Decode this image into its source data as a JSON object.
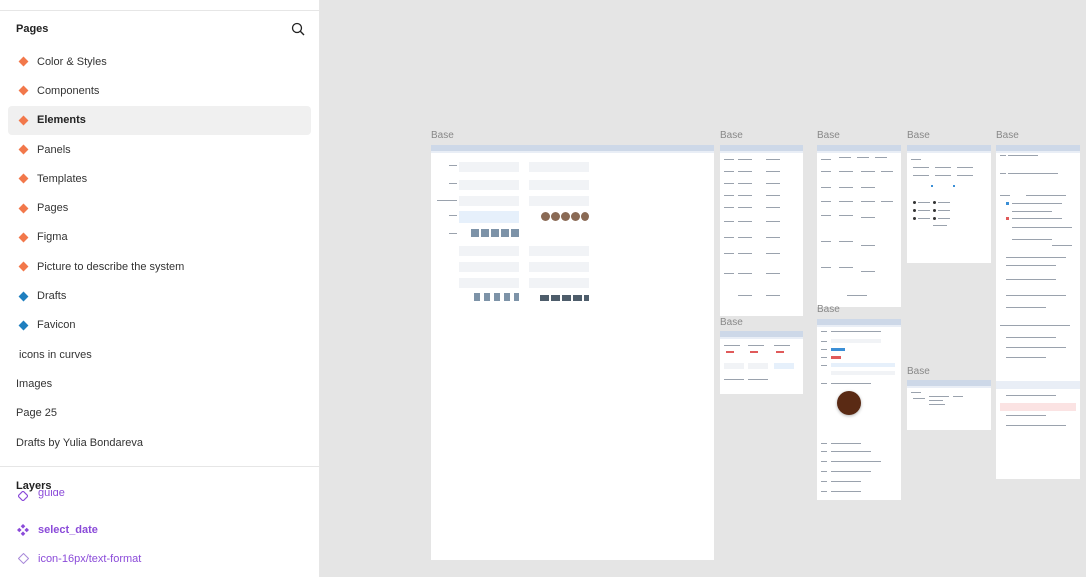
{
  "sidebar": {
    "pages_title": "Pages",
    "pages": [
      {
        "label": "Color & Styles",
        "icon": "orange-diamond-icon",
        "selected": false
      },
      {
        "label": "Components",
        "icon": "orange-diamond-icon",
        "selected": false
      },
      {
        "label": "Elements",
        "icon": "orange-diamond-icon",
        "selected": true
      },
      {
        "label": "Panels",
        "icon": "orange-diamond-icon",
        "selected": false
      },
      {
        "label": "Templates",
        "icon": "orange-diamond-icon",
        "selected": false
      },
      {
        "label": "Pages",
        "icon": "orange-diamond-icon",
        "selected": false
      },
      {
        "label": "Figma",
        "icon": "orange-diamond-icon",
        "selected": false
      },
      {
        "label": "Picture to describe the system",
        "icon": "orange-diamond-icon",
        "selected": false
      },
      {
        "label": "Drafts",
        "icon": "blue-diamond-icon",
        "selected": false
      },
      {
        "label": "Favicon",
        "icon": "blue-diamond-icon",
        "selected": false
      },
      {
        "label": "icons in curves",
        "icon": "",
        "selected": false
      },
      {
        "label": "Images",
        "icon": "",
        "selected": false
      },
      {
        "label": "Page 25",
        "icon": "",
        "selected": false
      },
      {
        "label": "Drafts by Yulia Bondareva",
        "icon": "",
        "selected": false
      }
    ],
    "layers_title": "Layers",
    "layers": [
      {
        "label": "guide",
        "icon": "component-icon"
      },
      {
        "label": "select_date",
        "icon": "component-set-icon"
      },
      {
        "label": "icon-16px/text-format",
        "icon": "instance-icon"
      }
    ]
  },
  "canvas": {
    "frames": [
      {
        "label": "Base"
      },
      {
        "label": "Base"
      },
      {
        "label": "Base"
      },
      {
        "label": "Base"
      },
      {
        "label": "Base"
      },
      {
        "label": "Base"
      },
      {
        "label": "Base"
      },
      {
        "label": "Base"
      }
    ]
  },
  "colors": {
    "page_orange": "#f2784b",
    "page_blue": "#1f7fbf",
    "layer_purple": "#8b4bd9",
    "canvas_bg": "#e5e5e5"
  }
}
